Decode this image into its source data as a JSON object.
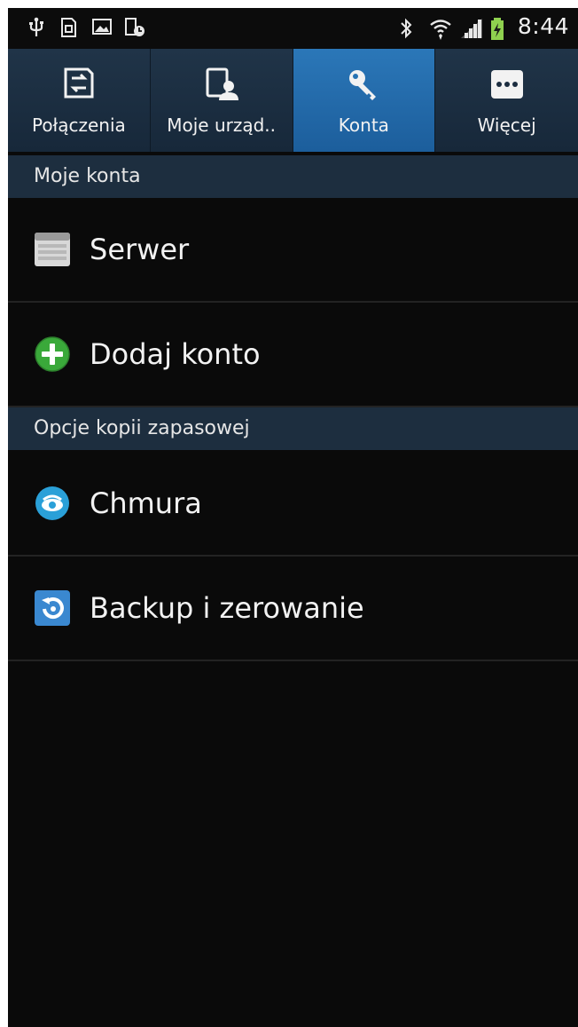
{
  "status_bar": {
    "left_icons": [
      "usb-icon",
      "sd-card-icon",
      "image-icon",
      "screenshot-icon"
    ],
    "right_icons": [
      "bluetooth-icon",
      "wifi-icon",
      "signal-icon",
      "battery-charging-icon"
    ],
    "time": "8:44"
  },
  "tabs": [
    {
      "label": "Połączenia",
      "icon": "connections-icon",
      "active": false
    },
    {
      "label": "Moje urząd..",
      "icon": "my-device-icon",
      "active": false
    },
    {
      "label": "Konta",
      "icon": "key-icon",
      "active": true
    },
    {
      "label": "Więcej",
      "icon": "more-icon",
      "active": false
    }
  ],
  "sections": [
    {
      "title": "Moje konta",
      "items": [
        {
          "label": "Serwer",
          "icon": "server-icon"
        },
        {
          "label": "Dodaj konto",
          "icon": "add-icon"
        }
      ]
    },
    {
      "title": "Opcje kopii zapasowej",
      "items": [
        {
          "label": "Chmura",
          "icon": "cloud-sync-icon"
        },
        {
          "label": "Backup i zerowanie",
          "icon": "backup-reset-icon"
        }
      ]
    }
  ],
  "colors": {
    "background": "#0a0a0a",
    "tabbar": "#1b2d40",
    "tab_active": "#2468a8",
    "section_header": "#1d2e3f",
    "add_green": "#3aa93a",
    "cloud_blue": "#2aa0d8"
  }
}
